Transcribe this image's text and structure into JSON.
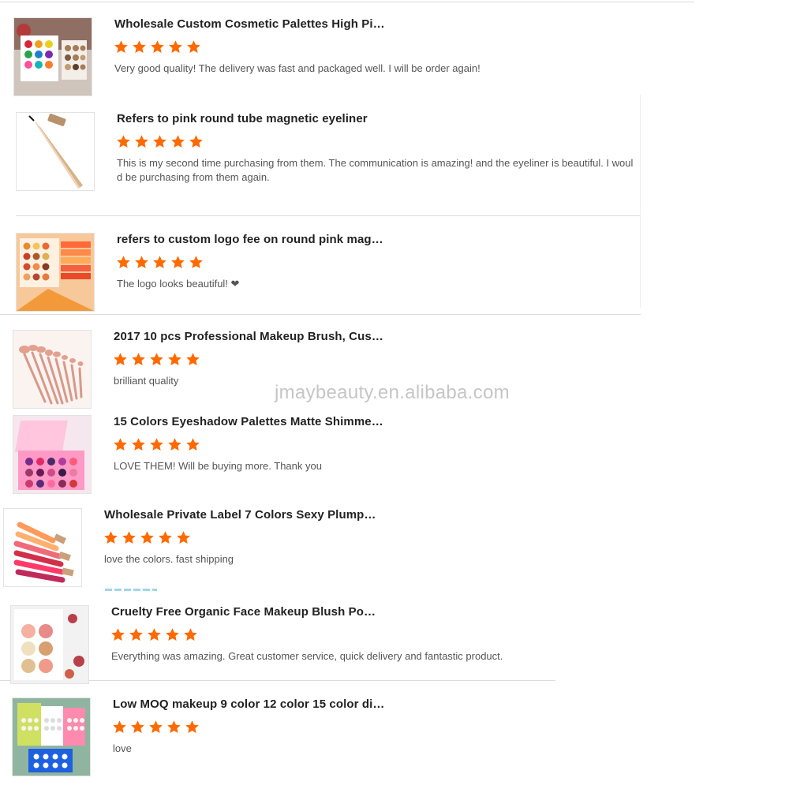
{
  "theme": {
    "star_color": "#ff6a00"
  },
  "watermark": "jmaybeauty.en.alibaba.com",
  "reviews": [
    {
      "title": "Wholesale Custom Cosmetic Palettes High Pig...",
      "rating": 5,
      "comment": "Very good quality! The delivery was fast and packaged well. I will be order again!",
      "image": "eyeshadow-palette-photo"
    },
    {
      "title": "Refers to pink round tube magnetic eyeliner",
      "rating": 5,
      "comment": "This is my second time purchasing from them. The communication is amazing! and the eyeliner is beautiful. I would be purchasing from them again.",
      "image": "eyeliner-photo"
    },
    {
      "title": "refers to custom logo fee on round pink magne...",
      "rating": 5,
      "comment": "The logo looks beautiful! ❤",
      "image": "orange-palette-photo"
    },
    {
      "title": "2017 10 pcs Professional Makeup Brush, Custom Log...",
      "rating": 5,
      "comment": "brilliant quality",
      "image": "makeup-brush-photo"
    },
    {
      "title": "15 Colors Eyeshadow Palettes Matte Shimmer ...",
      "rating": 5,
      "comment": "LOVE THEM! Will be buying more. Thank you",
      "image": "pink-palette-photo"
    },
    {
      "title": "Wholesale Private Label 7 Colors Sexy Plumpin...",
      "rating": 5,
      "comment": "love the colors. fast shipping",
      "image": "lip-gloss-photo"
    },
    {
      "title": "Cruelty Free Organic Face Makeup Blush Powd...",
      "rating": 5,
      "comment": "Everything was amazing. Great customer service, quick delivery and fantastic product.",
      "image": "blush-palette-photo"
    },
    {
      "title": "Low MOQ makeup 9 color 12 color 15 color diy...",
      "rating": 5,
      "comment": "love",
      "image": "diy-palette-photo"
    }
  ]
}
